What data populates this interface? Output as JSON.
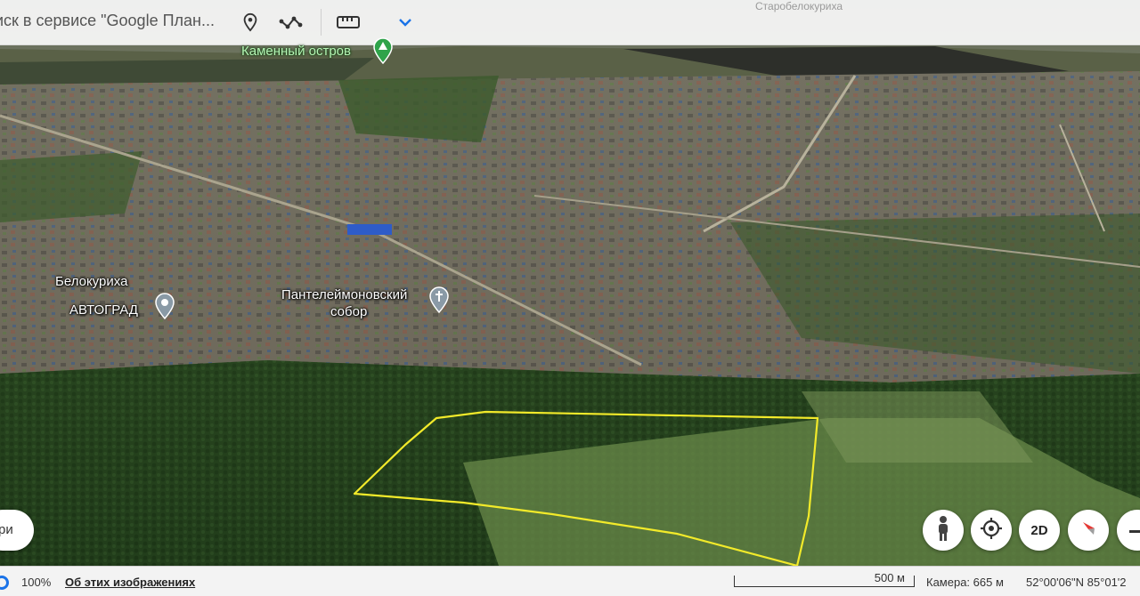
{
  "search": {
    "text": "иск в сервисе \"Google План..."
  },
  "toolbar": {
    "icons": [
      "location-pin-icon",
      "route-icon",
      "ruler-icon",
      "chevron-down-icon"
    ]
  },
  "map": {
    "top_place": "Старобелокуриха",
    "places": {
      "kamenny": "Каменный остров",
      "belokurikha": "Белокуриха",
      "avtograd": "АВТОГРАД",
      "sobor_line1": "Пантелеймоновский",
      "sobor_line2": "собор"
    },
    "polygon_color": "#f2ea2a"
  },
  "controls": {
    "left_pill": "ри",
    "twod": "2D",
    "icons": [
      "pegman-icon",
      "my-location-icon",
      "compass-icon",
      "zoom-out-icon"
    ]
  },
  "status": {
    "loading": "100%",
    "about": "Об этих изображениях",
    "scale": "500 м",
    "camera": "Камера: 665 м",
    "coords": "52°00'06\"N 85°01'2"
  }
}
